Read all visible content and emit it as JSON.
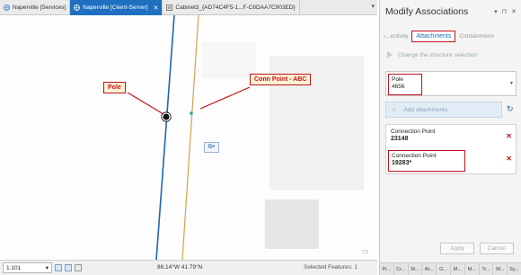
{
  "tabs": [
    {
      "label": "Naperville [Services]",
      "active": false,
      "closable": false
    },
    {
      "label": "Naperville [Client-Server]",
      "active": true,
      "closable": true
    },
    {
      "label": "Cabinet3_{AD74C4F5-1...F-C6DAA7C903ED}",
      "active": false,
      "closable": false
    }
  ],
  "map": {
    "callouts": {
      "pole": "Pole",
      "conn_point": "Conn Point - ABC"
    },
    "colors": {
      "callout_border": "#c0161b",
      "callout_fill": "#fdf1d6",
      "blue_line": "#1e64b8",
      "tan_line": "#d6a24a",
      "junction": "#2aa59a"
    }
  },
  "statusbar": {
    "scale": "1:101",
    "coordinates": "88.14°W 41.79°N",
    "selected_features": "Selected Features: 1"
  },
  "panel": {
    "title": "Modify Associations",
    "tabs": {
      "left": "...ectivity",
      "active": "Attachments",
      "right": "Containment"
    },
    "structure_selection_label": "Change the structure selection",
    "structure": {
      "type": "Pole",
      "id": "4656"
    },
    "add_attachments_label": "Add attachments",
    "attachments": [
      {
        "type": "Connection Point",
        "id": "23148"
      },
      {
        "type": "Connection Point",
        "id": "19283*"
      }
    ],
    "apply_label": "Apply",
    "cancel_label": "Cancel",
    "bottom_tabs": [
      "Pr...",
      "Cr...",
      "M...",
      "At...",
      "G...",
      "M...",
      "M...",
      "Tr...",
      "M...",
      "Sy..."
    ],
    "accent_color": "#1e6fbf"
  }
}
